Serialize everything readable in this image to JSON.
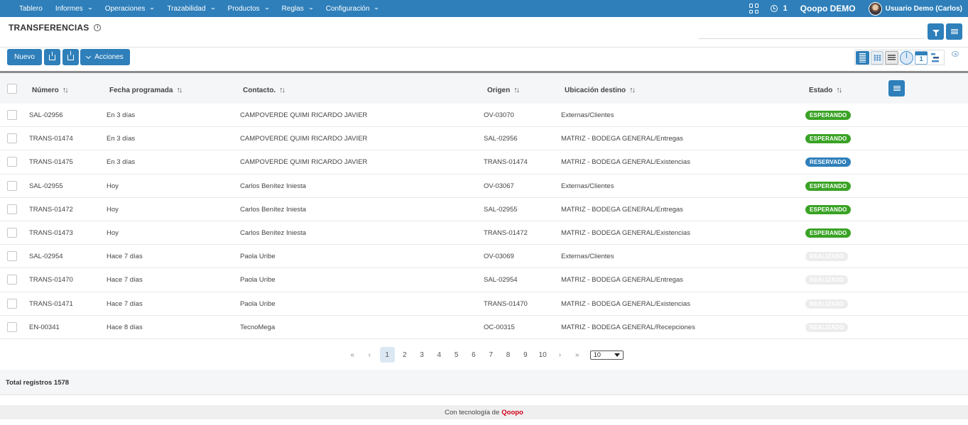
{
  "topnav": {
    "items": [
      "Tablero",
      "Informes",
      "Operaciones",
      "Trazabilidad",
      "Productos",
      "Reglas",
      "Configuración"
    ],
    "counter": "1",
    "company": "Qoopo DEMO",
    "user": "Usuario Demo (Carlos)",
    "icons": [
      "apps-grid-icon",
      "clock-icon",
      "avatar"
    ]
  },
  "page": {
    "title": "TRANSFERENCIAS",
    "info_icon": "i"
  },
  "toolbar": {
    "new_label": "Nuevo",
    "actions_label": "Acciones",
    "views": [
      "list-view-icon",
      "grid-view-icon",
      "card-view-icon",
      "pie-view-icon",
      "calendar-view-icon",
      "gantt-view-icon"
    ]
  },
  "table": {
    "columns": {
      "numero": "Número",
      "fecha": "Fecha programada",
      "contacto": "Contacto.",
      "origen": "Origen",
      "destino": "Ubicación destino",
      "estado": "Estado"
    },
    "sort_icon": "↑↓",
    "rows": [
      {
        "numero": "SAL-02956",
        "fecha": "En 3 días",
        "contacto": "CAMPOVERDE QUIMI RICARDO JAVIER",
        "origen": "OV-03070",
        "destino": "Externas/Clientes",
        "estado": "ESPERANDO"
      },
      {
        "numero": "TRANS-01474",
        "fecha": "En 3 días",
        "contacto": "CAMPOVERDE QUIMI RICARDO JAVIER",
        "origen": "SAL-02956",
        "destino": "MATRIZ - BODEGA GENERAL/Entregas",
        "estado": "ESPERANDO"
      },
      {
        "numero": "TRANS-01475",
        "fecha": "En 3 días",
        "contacto": "CAMPOVERDE QUIMI RICARDO JAVIER",
        "origen": "TRANS-01474",
        "destino": "MATRIZ - BODEGA GENERAL/Existencias",
        "estado": "RESERVADO"
      },
      {
        "numero": "SAL-02955",
        "fecha": "Hoy",
        "contacto": "Carlos Benítez Iniesta",
        "origen": "OV-03067",
        "destino": "Externas/Clientes",
        "estado": "ESPERANDO"
      },
      {
        "numero": "TRANS-01472",
        "fecha": "Hoy",
        "contacto": "Carlos Benítez Iniesta",
        "origen": "SAL-02955",
        "destino": "MATRIZ - BODEGA GENERAL/Entregas",
        "estado": "ESPERANDO"
      },
      {
        "numero": "TRANS-01473",
        "fecha": "Hoy",
        "contacto": "Carlos Benítez Iniesta",
        "origen": "TRANS-01472",
        "destino": "MATRIZ - BODEGA GENERAL/Existencias",
        "estado": "ESPERANDO"
      },
      {
        "numero": "SAL-02954",
        "fecha": "Hace 7 días",
        "contacto": "Paola Uribe",
        "origen": "OV-03069",
        "destino": "Externas/Clientes",
        "estado": "REALIZADO"
      },
      {
        "numero": "TRANS-01470",
        "fecha": "Hace 7 días",
        "contacto": "Paola Uribe",
        "origen": "SAL-02954",
        "destino": "MATRIZ - BODEGA GENERAL/Entregas",
        "estado": "REALIZADO"
      },
      {
        "numero": "TRANS-01471",
        "fecha": "Hace 7 días",
        "contacto": "Paola Uribe",
        "origen": "TRANS-01470",
        "destino": "MATRIZ - BODEGA GENERAL/Existencias",
        "estado": "REALIZADO"
      },
      {
        "numero": "EN-00341",
        "fecha": "Hace 8 días",
        "contacto": "TecnoMega",
        "origen": "OC-00315",
        "destino": "MATRIZ - BODEGA GENERAL/Recepciones",
        "estado": "REALIZADO"
      }
    ],
    "status_colors": {
      "ESPERANDO": "#3aa325",
      "RESERVADO": "#2e7fba",
      "REALIZADO": "#ececec"
    }
  },
  "pagination": {
    "first": "«",
    "prev": "‹",
    "pages": [
      "1",
      "2",
      "3",
      "4",
      "5",
      "6",
      "7",
      "8",
      "9",
      "10"
    ],
    "current": "1",
    "next": "›",
    "last": "»",
    "page_size": "10"
  },
  "summary": {
    "total_label": "Total registros 1578"
  },
  "footer": {
    "text": "Con tecnología de",
    "brand": "Qoopo"
  },
  "colors": {
    "primary": "#2e7fba",
    "brand": "#d0021b"
  }
}
